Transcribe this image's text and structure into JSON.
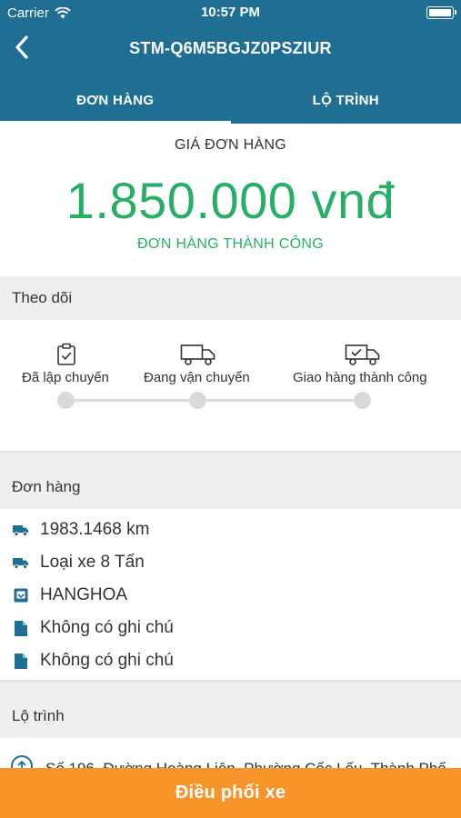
{
  "status_bar": {
    "carrier": "Carrier",
    "time": "10:57 PM"
  },
  "nav": {
    "title": "STM-Q6M5BGJZ0PSZIUR"
  },
  "tabs": [
    {
      "label": "ĐƠN HÀNG",
      "active": true
    },
    {
      "label": "LỘ TRÌNH",
      "active": false
    }
  ],
  "price": {
    "label": "GIÁ ĐƠN HÀNG",
    "value": "1.850.000 vnđ",
    "status": "ĐƠN HÀNG THÀNH CÔNG"
  },
  "tracking": {
    "title": "Theo dõi",
    "steps": [
      {
        "label": "Đã lập chuyến",
        "icon": "clipboard-check-icon"
      },
      {
        "label": "Đang vận chuyển",
        "icon": "truck-icon"
      },
      {
        "label": "Giao hàng thành công",
        "icon": "truck-check-icon"
      }
    ]
  },
  "order": {
    "title": "Đơn hàng",
    "items": [
      {
        "icon": "truck-icon",
        "text": "1983.1468 km"
      },
      {
        "icon": "truck-icon",
        "text": "Loại xe 8 Tấn"
      },
      {
        "icon": "package-icon",
        "text": "HANGHOA"
      },
      {
        "icon": "file-icon",
        "text": "Không có ghi chú"
      },
      {
        "icon": "file-icon",
        "text": "Không có ghi chú"
      }
    ]
  },
  "route": {
    "title": "Lộ trình",
    "first_address": "Số 196, Đường Hoàng Liên, Phường Cốc Lếu, Thành Phố"
  },
  "actions": {
    "dispatch_label": "Điều phối xe"
  },
  "colors": {
    "header": "#1f6f94",
    "success": "#27b065",
    "cta": "#f7942a",
    "icon": "#1f6f94"
  }
}
